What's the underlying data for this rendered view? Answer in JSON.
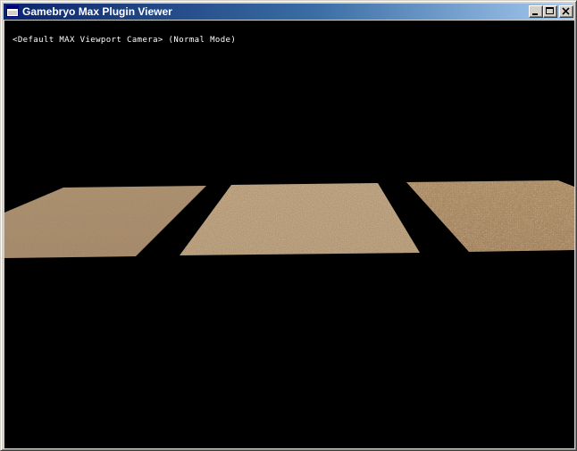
{
  "window": {
    "title": "Gamebryo Max Plugin Viewer",
    "icon": "app-window-icon",
    "buttons": {
      "minimize_icon": "minimize-icon",
      "maximize_icon": "maximize-icon",
      "close_icon": "close-icon"
    }
  },
  "viewport": {
    "overlay_text": "<Default MAX Viewport Camera> (Normal Mode)",
    "background": "#000000",
    "planes": [
      {
        "name": "left-terrain-plane",
        "texture": "fine-sand",
        "base_color": "#a58764"
      },
      {
        "name": "middle-terrain-plane",
        "texture": "medium-sand",
        "base_color": "#a5875f"
      },
      {
        "name": "right-terrain-plane",
        "texture": "coarse-gravel",
        "base_color": "#aa8860"
      }
    ]
  },
  "colors": {
    "titlebar_start": "#0a246a",
    "titlebar_end": "#a6caf0",
    "window_face": "#d4d0c8"
  }
}
